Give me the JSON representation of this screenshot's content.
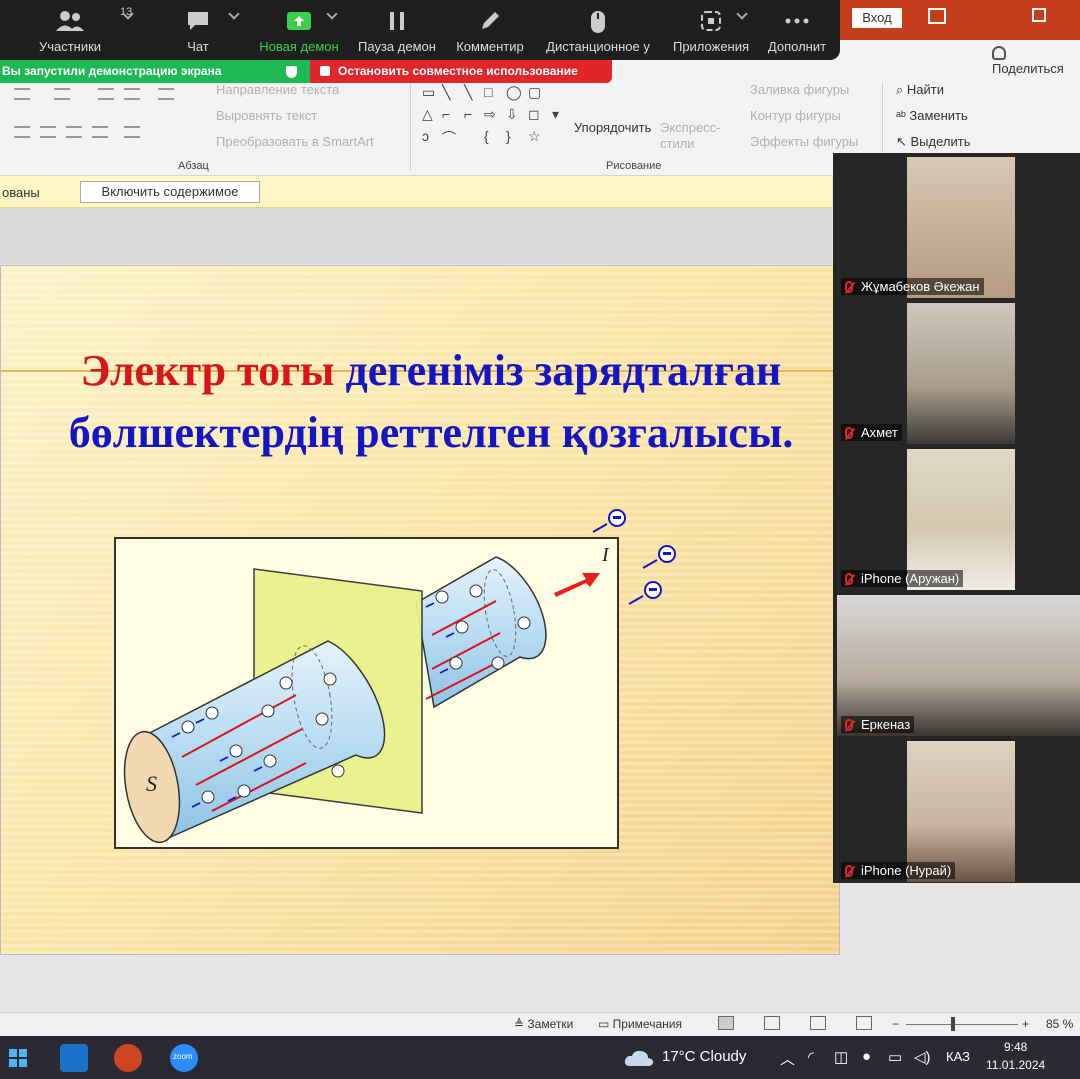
{
  "zoom_toolbar": {
    "participants_label": "Участники",
    "participants_count": "13",
    "chat_label": "Чат",
    "new_share_label": "Новая демон",
    "pause_share_label": "Пауза демон",
    "annotate_label": "Комментир",
    "remote_control_label": "Дистанционное у",
    "apps_label": "Приложения",
    "more_label": "Дополнит"
  },
  "share_banner": {
    "status": "Вы запустили демонстрацию экрана",
    "stop_label": "Остановить совместное использование"
  },
  "window": {
    "login_label": "Вход",
    "share_label": "Поделиться"
  },
  "ribbon": {
    "text_direction": "Направление текста",
    "align_text": "Выровнять текст",
    "smartart": "Преобразовать в SmartArt",
    "paragraph_group": "Абзац",
    "arrange": "Упорядочить",
    "quick_styles": "Экспресс-стили",
    "shape_fill": "Заливка фигуры",
    "shape_outline": "Контур фигуры",
    "shape_effects": "Эффекты фигуры",
    "drawing_group": "Рисование",
    "find": "Найти",
    "replace": "Заменить",
    "select": "Выделить"
  },
  "message_bar": {
    "text": "ованы",
    "button": "Включить содержимое"
  },
  "slide": {
    "title_red": "Электр тогы",
    "title_blue": " дегеніміз зарядталған бөлшектердің реттелген қозғалысы.",
    "figure": {
      "cross_section_label": "S",
      "current_label": "I"
    }
  },
  "participants": [
    {
      "name": "Жұмабеков Әкежан",
      "muted": true
    },
    {
      "name": "Ахмет",
      "muted": true
    },
    {
      "name": "iPhone (Аружан)",
      "muted": true
    },
    {
      "name": "Еркеназ",
      "muted": true
    },
    {
      "name": "iPhone (Нурай)",
      "muted": true
    }
  ],
  "status_bar": {
    "notes": "Заметки",
    "comments": "Примечания",
    "zoom_minus": "−",
    "zoom_plus": "+",
    "zoom_level": "85 %"
  },
  "taskbar": {
    "zoom_app_label": "zoom",
    "weather": "17°C  Cloudy",
    "language": "КАЗ",
    "time": "9:48",
    "date": "11.01.2024"
  }
}
